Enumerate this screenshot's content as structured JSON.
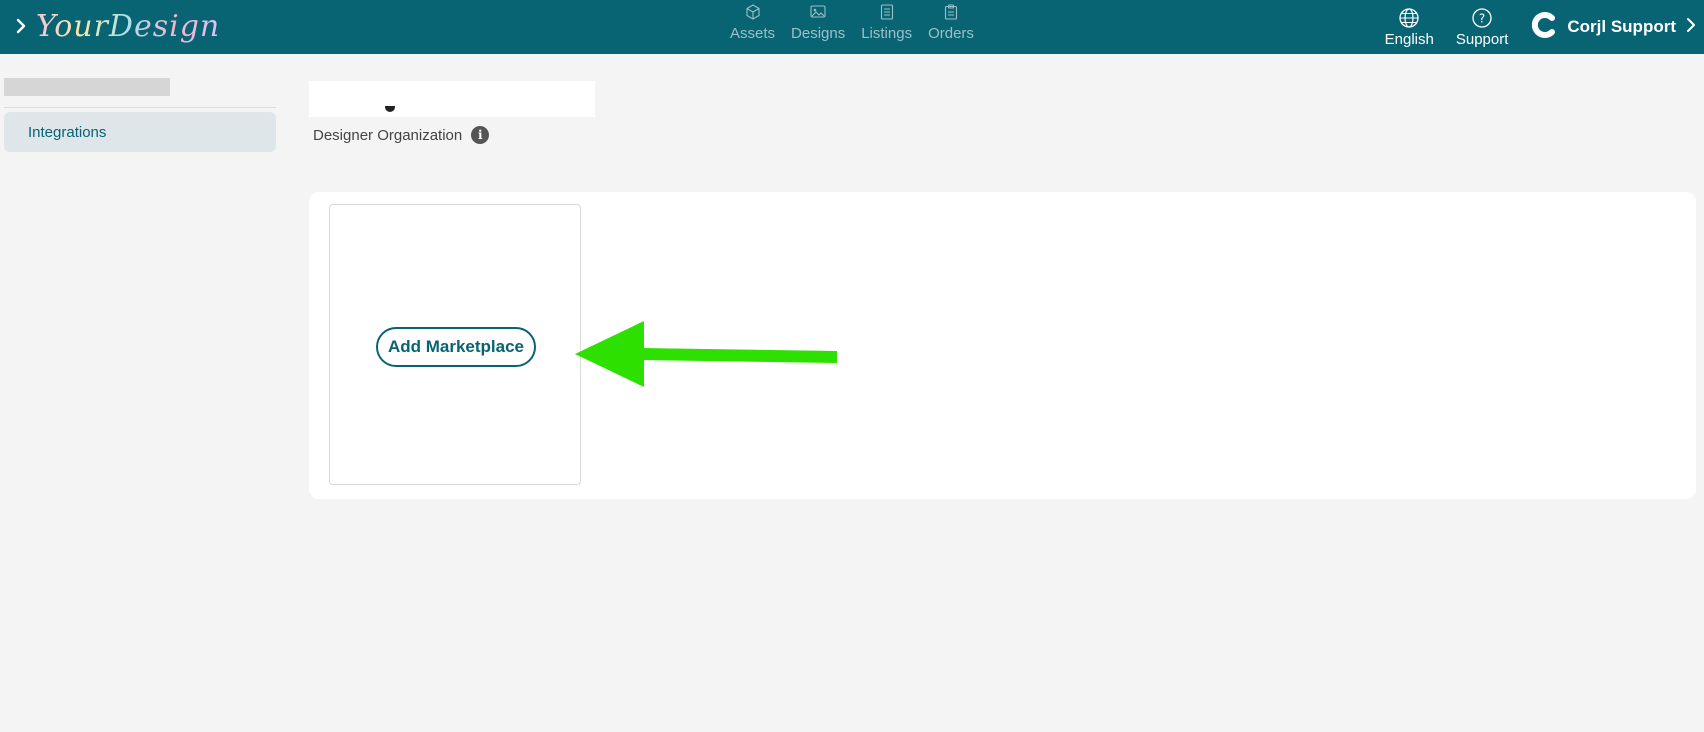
{
  "header": {
    "logo_text": "YourDesign",
    "nav": [
      {
        "label": "Assets",
        "icon": "cube-icon"
      },
      {
        "label": "Designs",
        "icon": "layers-icon"
      },
      {
        "label": "Listings",
        "icon": "list-icon"
      },
      {
        "label": "Orders",
        "icon": "clipboard-icon"
      }
    ],
    "tools": {
      "language_label": "English",
      "support_label": "Support"
    },
    "user_name": "Corjl Support"
  },
  "sidebar": {
    "items": [
      {
        "label": "Integrations",
        "active": true
      }
    ]
  },
  "page": {
    "subtitle": "Designer Organization"
  },
  "main": {
    "add_marketplace_label": "Add Marketplace"
  },
  "colors": {
    "topbar": "#086373",
    "accent": "#086373",
    "arrow": "#2de000"
  }
}
